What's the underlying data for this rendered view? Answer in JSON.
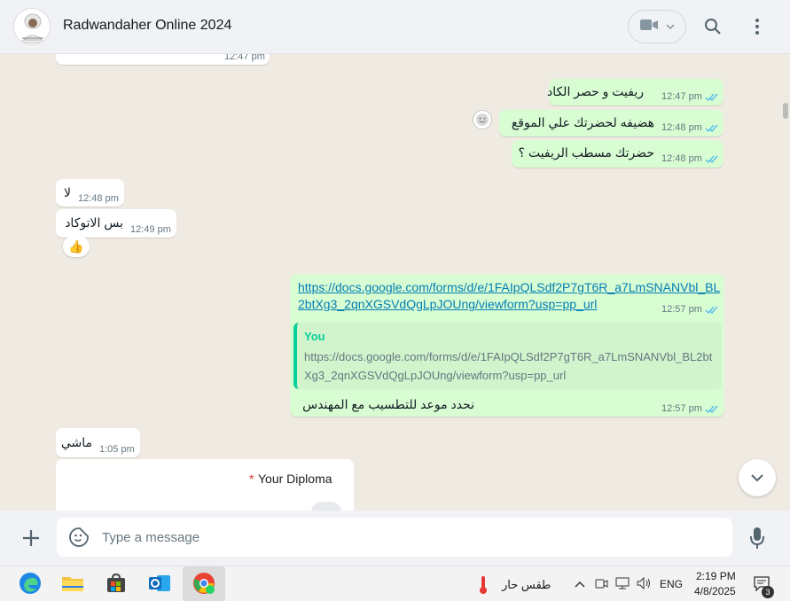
{
  "header": {
    "chat_name": "Radwandaher Online 2024"
  },
  "messages": [
    {
      "dir": "in",
      "text": "",
      "time": "12:47 pm"
    },
    {
      "dir": "out",
      "text": "ريفيت و حصر الكاد",
      "time": "12:47 pm"
    },
    {
      "dir": "out",
      "text": "هضيفه لحضرتك علي الموقع",
      "time": "12:48 pm"
    },
    {
      "dir": "out",
      "text": "حضرتك مسطب الريفيت ؟",
      "time": "12:48 pm"
    },
    {
      "dir": "in",
      "text": "لا",
      "time": "12:48 pm"
    },
    {
      "dir": "in",
      "text": "بس الاتوكاد",
      "time": "12:49 pm",
      "reaction": "👍"
    },
    {
      "dir": "out",
      "text": "https://docs.google.com/forms/d/e/1FAIpQLSdf2P7gT6R_a7LmSNANVbl_BL2btXg3_2qnXGSVdQgLpJOUng/viewform?usp=pp_url",
      "time": "12:57 pm"
    },
    {
      "dir": "out",
      "quote_author": "You",
      "quote_text": "https://docs.google.com/forms/d/e/1FAIpQLSdf2P7gT6R_a7LmSNANVbl_BL2btXg3_2qnXGSVdQgLpJOUng/viewform?usp=pp_url",
      "text": "نحدد موعد للتطسيب مع المهندس",
      "time": "12:57 pm"
    },
    {
      "dir": "in",
      "text": "ماشي",
      "time": "1:05 pm"
    },
    {
      "dir": "in",
      "text": "Your Diploma",
      "required_mark": "*"
    }
  ],
  "link_lines": [
    "https://docs.google.com/forms/d/e/1FAIpQLSdf2P7gT6R_a7LmSNANVbl_BL",
    "2btXg3_2qnXGSVdQgLpJOUng/viewform?usp=pp_url"
  ],
  "quote_lines": [
    "https://docs.google.com/forms/d/e/1FAIpQLSdf2P7gT6R_a7LmSNANVbl_BL2bt",
    "Xg3_2qnXGSVdQgLpJOUng/viewform?usp=pp_url"
  ],
  "composer": {
    "placeholder": "Type a message"
  },
  "taskbar": {
    "weather": "طقس حار",
    "language": "ENG",
    "time": "2:19 PM",
    "date": "4/8/2025",
    "notifications": "3"
  },
  "colors": {
    "outgoing_bubble": "#d9fdd3",
    "incoming_bubble": "#ffffff",
    "chat_background": "#efeae2",
    "tick_blue": "#53bdeb",
    "link": "#027eb5",
    "accent": "#06cf9c"
  },
  "icons": {
    "video": "video-camera-icon",
    "search": "search-icon",
    "menu": "kebab-menu-icon",
    "attach": "plus-icon",
    "sticker": "sticker-icon",
    "mic": "microphone-icon"
  }
}
